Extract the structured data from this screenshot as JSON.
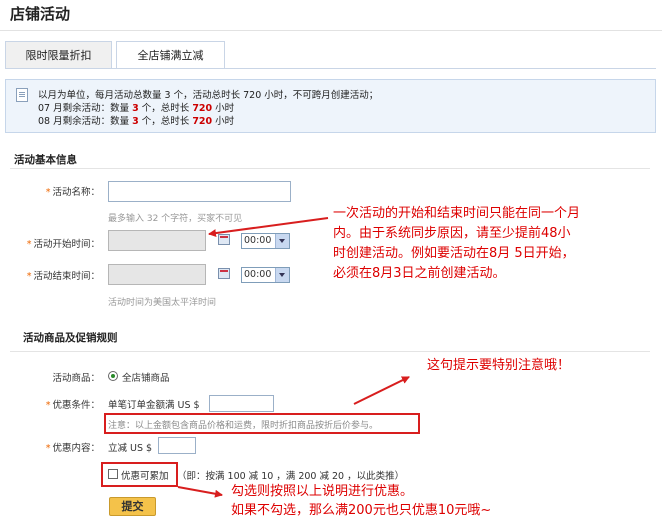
{
  "page": {
    "title": "店铺活动"
  },
  "tabs": [
    {
      "label": "限时限量折扣"
    },
    {
      "label": "全店铺满立减"
    }
  ],
  "notice": {
    "line1": "以月为单位，每月活动总数量 3 个，活动总时长 720 小时，不可跨月创建活动；",
    "months": [
      {
        "prefix": "07 月剩余活动：数量 ",
        "count": "3",
        "mid": " 个，总时长 ",
        "hours": "720",
        "suffix": " 小时"
      },
      {
        "prefix": "08 月剩余活动：数量 ",
        "count": "3",
        "mid": " 个，总时长 ",
        "hours": "720",
        "suffix": " 小时"
      }
    ]
  },
  "basic": {
    "heading": "活动基本信息",
    "name_label": "活动名称：",
    "name_value": "",
    "name_hint": "最多输入 32 个字符，买家不可见",
    "start_label": "活动开始时间：",
    "end_label": "活动结束时间：",
    "start_time": "00:00",
    "end_time": "00:00",
    "time_hint": "活动时间为美国太平洋时间"
  },
  "rules": {
    "heading": "活动商品及促销规则",
    "goods_label": "活动商品：",
    "goods_option": "全店铺商品",
    "cond_label": "优惠条件：",
    "cond_text": "单笔订单金额满 US $",
    "cond_value": "",
    "cond_note": "注意：以上金额包含商品价格和运费，限时折扣商品按折后价参与。",
    "content_label": "优惠内容：",
    "content_text": "立减 US $",
    "content_value": "",
    "stack_label": "优惠可累加",
    "stack_note": "（即：按满 100 减 10 ，满 200 减 20 ，以此类推）",
    "submit": "提交"
  },
  "annotations": {
    "time": [
      "一次活动的开始和结束时间只能在同一个月",
      "内。由于系统同步原因，请至少提前48小",
      "时创建活动。例如要活动在8月 5日开始，",
      "必须在8月3日之前创建活动。"
    ],
    "note": "这句提示要特别注意哦！",
    "stack": [
      "勾选则按照以上说明进行优惠。",
      "如果不勾选，那么满200元也只优惠10元哦~"
    ]
  },
  "colors": {
    "annotation": "#d00",
    "highlight": "#c00",
    "submit": "#f4c24a"
  }
}
